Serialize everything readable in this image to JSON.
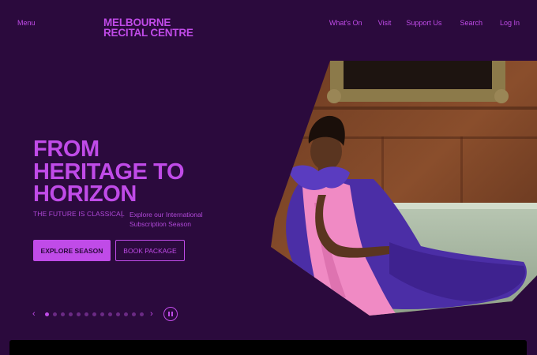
{
  "header": {
    "menu_label": "Menu",
    "logo_line1": "MELBOURNE",
    "logo_line2": "RECITAL CENTRE",
    "nav": [
      "What's On",
      "Visit",
      "Support Us",
      "Search",
      "Log In"
    ]
  },
  "hero": {
    "title_line1": "FROM",
    "title_line2": "HERITAGE TO",
    "title_line3": "HORIZON",
    "tagline": "THE FUTURE IS CLASSICAL",
    "subtext": "Explore our International Subscription Season",
    "primary_button": "EXPLORE SEASON",
    "secondary_button": "BOOK PACKAGE"
  },
  "carousel": {
    "prev_icon": "chevron-left-icon",
    "next_icon": "chevron-right-icon",
    "pause_icon": "pause-icon",
    "slide_count": 13,
    "active_index": 0
  },
  "colors": {
    "background": "#2b0a3d",
    "accent": "#c04be8",
    "muted": "#6b2a85"
  }
}
